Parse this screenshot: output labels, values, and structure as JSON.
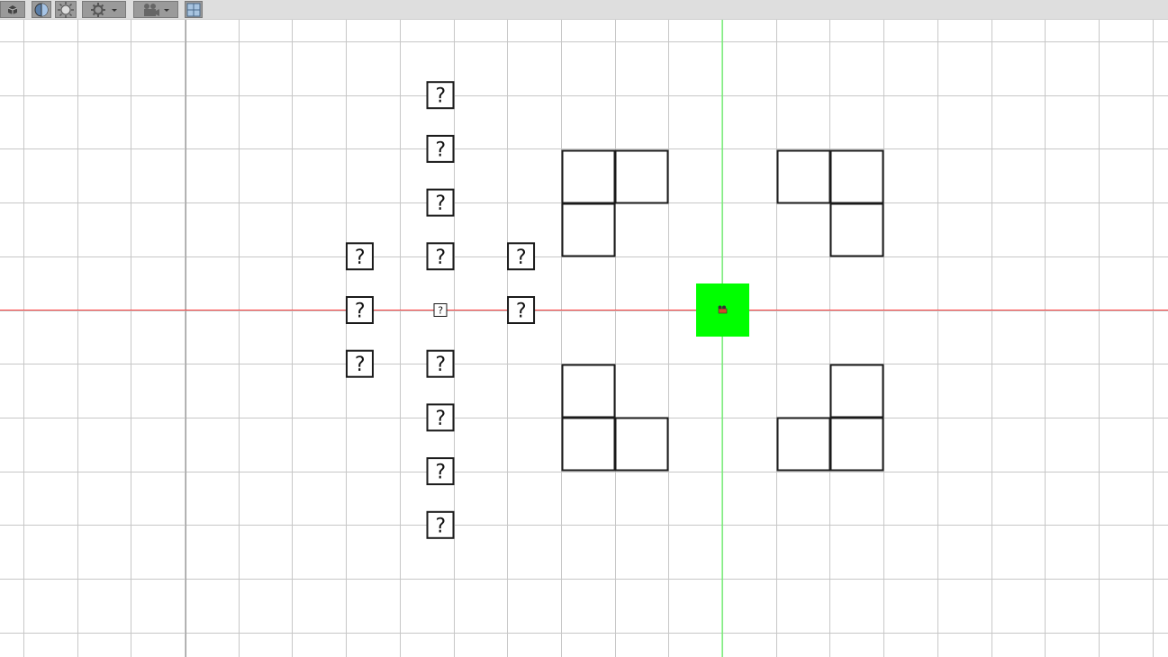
{
  "toolbar": {
    "buttons": [
      {
        "id": "2d",
        "icon": "view-2d-icon"
      },
      {
        "id": "sphere",
        "icon": "sphere-icon"
      },
      {
        "id": "lighting",
        "icon": "sun-icon"
      },
      {
        "id": "effects",
        "icon": "gear-dropdown-icon"
      },
      {
        "id": "camera",
        "icon": "camera-dropdown-icon"
      },
      {
        "id": "grid",
        "icon": "grid-icon"
      }
    ]
  },
  "scene": {
    "grid_color": "#c7c7c7",
    "major_grid_color": "#9e9e9e",
    "x_axis_color": "#ff4444",
    "y_axis_color": "#44ff44",
    "player_color": "#00ff00",
    "question_block_symbol": "?",
    "question_blocks": [
      {
        "col": 0,
        "row": -4
      },
      {
        "col": 0,
        "row": -3
      },
      {
        "col": 0,
        "row": -2
      },
      {
        "col": -1.5,
        "row": -1
      },
      {
        "col": 0,
        "row": -1
      },
      {
        "col": 1.5,
        "row": -1
      },
      {
        "col": -1.5,
        "row": 0
      },
      {
        "col": 0,
        "row": 0,
        "small": true
      },
      {
        "col": 1.5,
        "row": 0
      },
      {
        "col": -1.5,
        "row": 1
      },
      {
        "col": 0,
        "row": 1
      },
      {
        "col": 0,
        "row": 2
      },
      {
        "col": 0,
        "row": 3
      },
      {
        "col": 0,
        "row": 4
      }
    ],
    "tile_groups": [
      {
        "name": "top-left",
        "tiles": [
          [
            0,
            0
          ],
          [
            1,
            0
          ],
          [
            0,
            1
          ]
        ]
      },
      {
        "name": "top-right",
        "tiles": [
          [
            0,
            0
          ],
          [
            1,
            0
          ],
          [
            1,
            1
          ]
        ]
      },
      {
        "name": "bottom-left",
        "tiles": [
          [
            0,
            0
          ],
          [
            0,
            1
          ],
          [
            1,
            1
          ]
        ]
      },
      {
        "name": "bottom-right",
        "tiles": [
          [
            1,
            0
          ],
          [
            0,
            1
          ],
          [
            1,
            1
          ]
        ]
      }
    ]
  }
}
